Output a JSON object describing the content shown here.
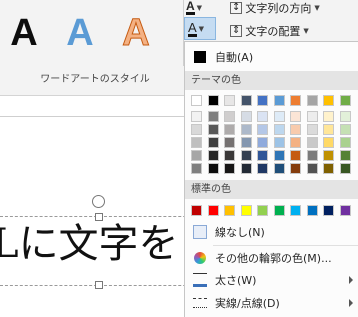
{
  "ribbon": {
    "wordart_letter": "A",
    "group_label": "ワードアートのスタイル",
    "text_direction_label": "文字列の方向",
    "align_label": "文字の配置"
  },
  "menu": {
    "auto_label": "自動(A)",
    "theme_colors_header": "テーマの色",
    "standard_colors_header": "標準の色",
    "no_line_label": "線なし(N)",
    "more_colors_label": "その他の輪郭の色(M)...",
    "weight_label": "太さ(W)",
    "dash_label": "実線/点線(D)"
  },
  "document": {
    "text": "Lに文字を"
  },
  "theme_colors": [
    [
      "#ffffff",
      "#f2f2f2",
      "#d9d9d9",
      "#bfbfbf",
      "#a6a6a6",
      "#7f7f7f"
    ],
    [
      "#000000",
      "#7f7f7f",
      "#595959",
      "#404040",
      "#262626",
      "#0d0d0d"
    ],
    [
      "#e7e6e6",
      "#d0cece",
      "#aeabab",
      "#757171",
      "#3a3838",
      "#171616"
    ],
    [
      "#44546a",
      "#d6dce5",
      "#adb9ca",
      "#8497b0",
      "#333f50",
      "#222a35"
    ],
    [
      "#4472c4",
      "#dae3f3",
      "#b4c7e7",
      "#8faadc",
      "#2f5597",
      "#1f3864"
    ],
    [
      "#5b9bd5",
      "#deebf7",
      "#bdd7ee",
      "#9dc3e6",
      "#2e75b6",
      "#1f4e79"
    ],
    [
      "#ed7d31",
      "#fbe5d6",
      "#f8cbad",
      "#f4b183",
      "#c55a11",
      "#843c0c"
    ],
    [
      "#a5a5a5",
      "#ededed",
      "#dbdbdb",
      "#c9c9c9",
      "#7b7b7b",
      "#525252"
    ],
    [
      "#ffc000",
      "#fff2cc",
      "#ffe699",
      "#ffd966",
      "#bf9000",
      "#7f6000"
    ],
    [
      "#70ad47",
      "#e2f0d9",
      "#c5e0b4",
      "#a9d18e",
      "#548235",
      "#385723"
    ]
  ],
  "standard_colors": [
    "#c00000",
    "#ff0000",
    "#ffc000",
    "#ffff00",
    "#92d050",
    "#00b050",
    "#00b0f0",
    "#0070c0",
    "#002060",
    "#7030a0"
  ],
  "colors": {
    "accent_blue": "#5b9bd5",
    "menu_bg": "#fcfcfc",
    "section_bg": "#e4e4e4"
  }
}
